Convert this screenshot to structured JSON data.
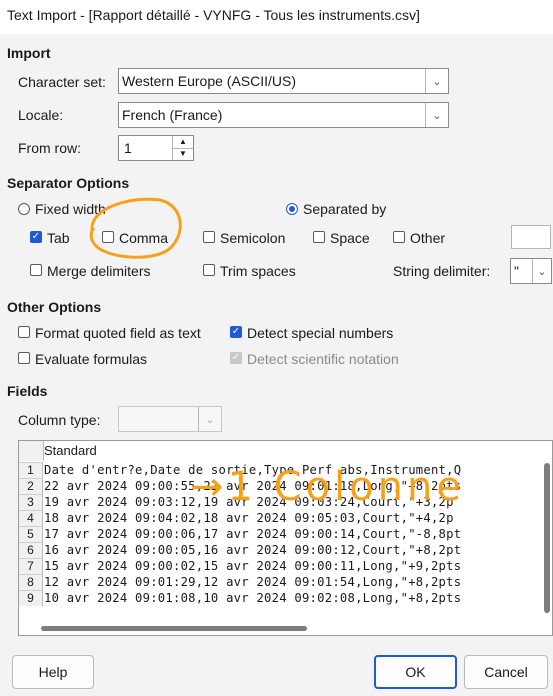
{
  "window": {
    "title": "Text Import - [Rapport détaillé - VYNFG - Tous les instruments.csv]"
  },
  "import": {
    "heading": "Import",
    "charset_label": "Character set:",
    "charset_value": "Western Europe (ASCII/US)",
    "locale_label": "Locale:",
    "locale_value": "French (France)",
    "fromrow_label": "From row:",
    "fromrow_value": "1"
  },
  "separator": {
    "heading": "Separator Options",
    "fixed_width": "Fixed width",
    "separated_by": "Separated by",
    "tab": "Tab",
    "comma": "Comma",
    "semicolon": "Semicolon",
    "space": "Space",
    "other": "Other",
    "merge": "Merge delimiters",
    "trim": "Trim spaces",
    "string_delim_label": "String delimiter:",
    "string_delim_value": "\""
  },
  "other_options": {
    "heading": "Other Options",
    "format_quoted": "Format quoted field as text",
    "detect_special": "Detect special numbers",
    "evaluate_formulas": "Evaluate formulas",
    "detect_scientific": "Detect scientific notation"
  },
  "fields": {
    "heading": "Fields",
    "column_type_label": "Column type:",
    "column_header": "Standard",
    "rows": [
      "Date d'entr?e,Date de sortie,Type,Perf abs,Instrument,Q",
      "22 avr 2024 09:00:55,22 avr 2024 09:01:18,Long,\"+8,2pts",
      "19 avr 2024 09:03:12,19 avr 2024 09:03:24,Court,\"+3,2p",
      "18 avr 2024 09:04:02,18 avr 2024 09:05:03,Court,\"+4,2p",
      "17 avr 2024 09:00:06,17 avr 2024 09:00:14,Court,\"-8,8pt",
      "16 avr 2024 09:00:05,16 avr 2024 09:00:12,Court,\"+8,2pt",
      "15 avr 2024 09:00:02,15 avr 2024 09:00:11,Long,\"+9,2pts",
      "12 avr 2024 09:01:29,12 avr 2024 09:01:54,Long,\"+8,2pts",
      "10 avr 2024 09:01:08,10 avr 2024 09:02:08,Long,\"+8,2pts"
    ]
  },
  "annotation": {
    "text": "→1 Colonne",
    "color": "#f7a11a"
  },
  "buttons": {
    "help": "Help",
    "ok": "OK",
    "cancel": "Cancel"
  },
  "colors": {
    "accent": "#1f5bd2",
    "annotation": "#f7a11a"
  }
}
